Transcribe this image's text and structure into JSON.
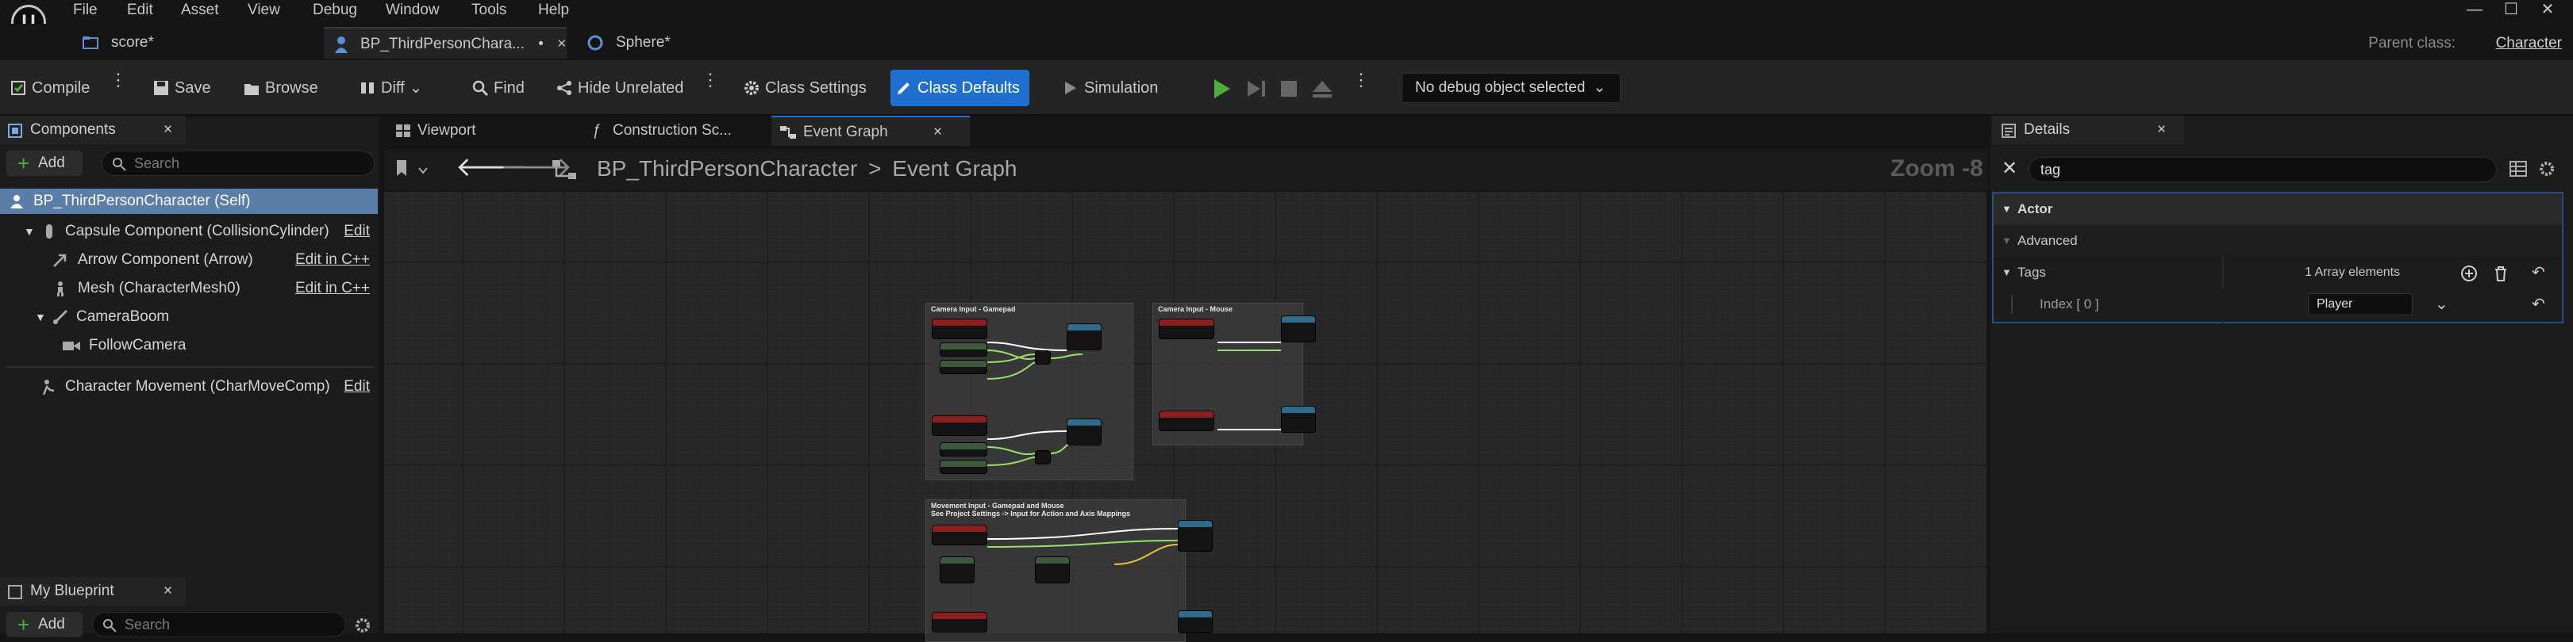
{
  "menu": [
    "File",
    "Edit",
    "Asset",
    "View",
    "Debug",
    "Window",
    "Tools",
    "Help"
  ],
  "doc_tabs": [
    {
      "label": "score*"
    },
    {
      "label": "BP_ThirdPersonChara...",
      "modified": "•",
      "close": "×"
    },
    {
      "label": "Sphere*"
    }
  ],
  "parent_class": {
    "label": "Parent class:",
    "value": "Character"
  },
  "window_controls": {
    "minimize": "—",
    "maximize": "☐",
    "close": "✕"
  },
  "toolbar": {
    "compile": "Compile",
    "save": "Save",
    "browse": "Browse",
    "diff": "Diff",
    "find": "Find",
    "hide_unrelated": "Hide Unrelated",
    "class_settings": "Class Settings",
    "class_defaults": "Class Defaults",
    "simulation": "Simulation",
    "debug_object": "No debug object selected"
  },
  "components": {
    "title": "Components",
    "add": "Add",
    "search_placeholder": "Search",
    "items": [
      {
        "label": "BP_ThirdPersonCharacter (Self)"
      },
      {
        "label": "Capsule Component (CollisionCylinder)",
        "action": "Edit"
      },
      {
        "label": "Arrow Component (Arrow)",
        "action": "Edit in C++"
      },
      {
        "label": "Mesh (CharacterMesh0)",
        "action": "Edit in C++"
      },
      {
        "label": "CameraBoom"
      },
      {
        "label": "FollowCamera"
      },
      {
        "label": "Character Movement (CharMoveComp)",
        "action": "Edit"
      }
    ]
  },
  "my_blueprint": {
    "title": "My Blueprint",
    "add": "Add",
    "search_placeholder": "Search"
  },
  "graph_tabs": [
    {
      "label": "Viewport"
    },
    {
      "label": "Construction Sc..."
    },
    {
      "label": "Event Graph",
      "close": "×"
    }
  ],
  "graph": {
    "breadcrumb_root": "BP_ThirdPersonCharacter",
    "breadcrumb_sep": ">",
    "breadcrumb_leaf": "Event Graph",
    "zoom": "Zoom -8",
    "comments": [
      {
        "title": "Camera Input - Gamepad"
      },
      {
        "title": "Camera Input - Mouse"
      },
      {
        "title": "Movement Input - Gamepad and Mouse"
      },
      {
        "subtitle": "See Project Settings -> Input for Action and Axis Mappings"
      }
    ]
  },
  "details": {
    "title": "Details",
    "search_value": "tag",
    "categories": [
      {
        "label": "Actor"
      },
      {
        "label": "Advanced"
      }
    ],
    "tags_label": "Tags",
    "tags_count": "1 Array elements",
    "index_label": "Index [ 0 ]",
    "index_value": "Player"
  },
  "colors": {
    "accent": "#1f6fd1",
    "selected_row": "#5b7ea8",
    "graph_bg": "#272727",
    "play_green": "#4caf3a"
  }
}
